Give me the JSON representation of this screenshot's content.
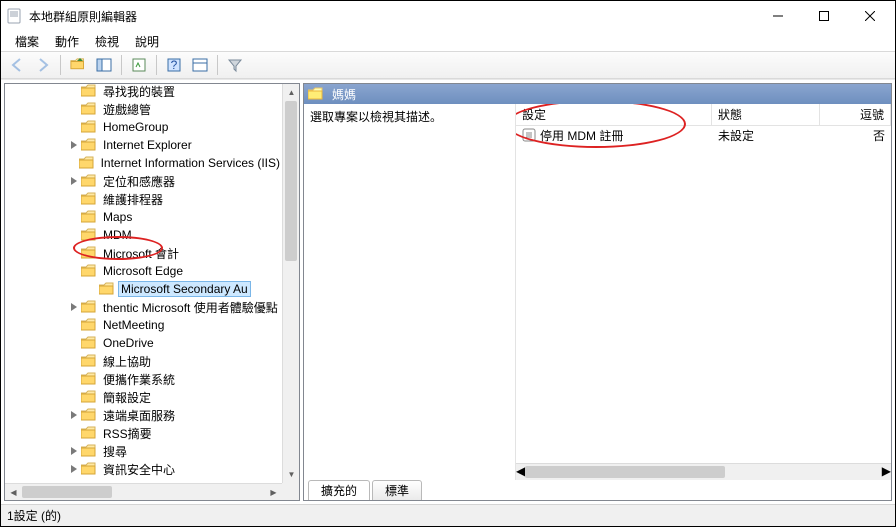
{
  "window": {
    "title": "本地群組原則編輯器"
  },
  "menu": {
    "file": "檔案",
    "action": "動作",
    "view": "檢視",
    "help": "說明"
  },
  "tree": {
    "indentBase": 62,
    "items": [
      {
        "label": "尋找我的裝置",
        "depth": 0,
        "expand": ""
      },
      {
        "label": "遊戲總管",
        "depth": 0,
        "expand": ""
      },
      {
        "label": "HomeGroup",
        "depth": 0,
        "expand": ""
      },
      {
        "label": "Internet Explorer",
        "depth": 0,
        "expand": ">"
      },
      {
        "label": "Internet Information Services (IIS)",
        "depth": 0,
        "expand": ""
      },
      {
        "label": "定位和感應器",
        "depth": 0,
        "expand": ">"
      },
      {
        "label": "維護排程器",
        "depth": 0,
        "expand": ""
      },
      {
        "label": "Maps",
        "depth": 0,
        "expand": ""
      },
      {
        "label": "MDM",
        "depth": 0,
        "expand": "",
        "hot": true
      },
      {
        "label": "Microsoft 會計",
        "depth": 0,
        "expand": ""
      },
      {
        "label": "Microsoft Edge",
        "depth": 0,
        "expand": ""
      },
      {
        "label": "Microsoft Secondary Au",
        "depth": 1,
        "expand": "",
        "selected": true
      },
      {
        "label": "thentic Microsoft 使用者體驗優點",
        "depth": 0,
        "expand": ">"
      },
      {
        "label": "NetMeeting",
        "depth": 0,
        "expand": ""
      },
      {
        "label": "OneDrive",
        "depth": 0,
        "expand": ""
      },
      {
        "label": "線上協助",
        "depth": 0,
        "expand": ""
      },
      {
        "label": "便攜作業系統",
        "depth": 0,
        "expand": ""
      },
      {
        "label": "簡報設定",
        "depth": 0,
        "expand": ""
      },
      {
        "label": "遠端桌面服務",
        "depth": 0,
        "expand": ">"
      },
      {
        "label": "RSS摘要",
        "depth": 0,
        "expand": ""
      },
      {
        "label": "搜尋",
        "depth": 0,
        "expand": ">"
      },
      {
        "label": "資訊安全中心",
        "depth": 0,
        "expand": ">"
      }
    ]
  },
  "right": {
    "headerTitle": "媽媽",
    "description": "選取專案以檢視其描述。",
    "columns": {
      "setting": "設定",
      "state": "狀態",
      "comment": "逗號"
    },
    "rows": [
      {
        "name": "停用 MDM 註冊",
        "state": "未設定",
        "comment": "否"
      }
    ],
    "tabs": {
      "extended": "擴充的",
      "standard": "標準"
    }
  },
  "status": {
    "text": "1設定 (的)"
  }
}
